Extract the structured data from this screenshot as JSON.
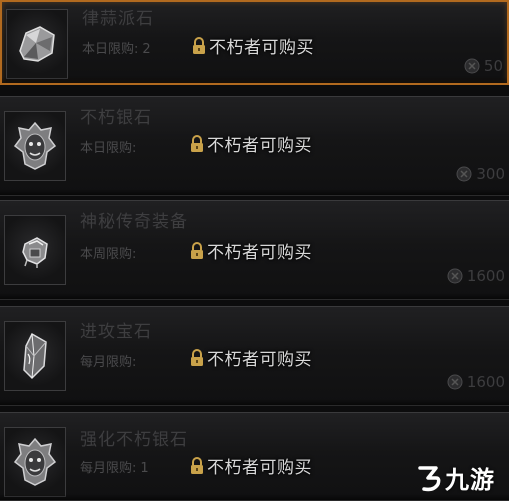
{
  "locked_text": "不朽者可购买",
  "colors": {
    "selected_border": "#b26a1f",
    "locked_text": "#d8d8d8",
    "dim_text": "#3e3e40"
  },
  "items": [
    {
      "name": "律蒜派石",
      "limit_label": "本日限购:",
      "limit_count": "2",
      "price": "50",
      "icon": "rock-icon",
      "selected": true
    },
    {
      "name": "不朽银石",
      "limit_label": "本日限购:",
      "limit_count": "",
      "price": "300",
      "icon": "demon-mask-icon",
      "selected": false
    },
    {
      "name": "神秘传奇装备",
      "limit_label": "本周限购:",
      "limit_count": "",
      "price": "1600",
      "icon": "gauntlet-icon",
      "selected": false
    },
    {
      "name": "进攻宝石",
      "limit_label": "每月限购:",
      "limit_count": "",
      "price": "1600",
      "icon": "crystal-icon",
      "selected": false
    },
    {
      "name": "强化不朽银石",
      "limit_label": "每月限购:",
      "limit_count": "1",
      "price": "",
      "icon": "demon-mask-icon",
      "selected": false
    }
  ],
  "watermark": {
    "text": "九游",
    "icon": "jiuyou-logo-icon"
  }
}
